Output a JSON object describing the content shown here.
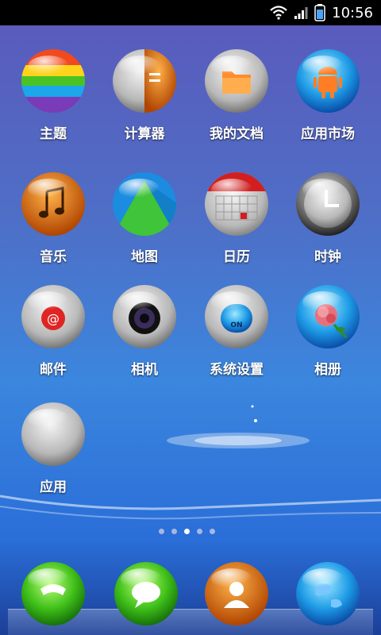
{
  "status_bar": {
    "time": "10:56",
    "icons": [
      "wifi-icon",
      "signal-icon",
      "battery-icon"
    ]
  },
  "apps": [
    {
      "label": "主题",
      "icon": "theme-icon"
    },
    {
      "label": "计算器",
      "icon": "calculator-icon"
    },
    {
      "label": "我的文档",
      "icon": "folder-icon"
    },
    {
      "label": "应用市场",
      "icon": "android-market-icon"
    },
    {
      "label": "音乐",
      "icon": "music-icon"
    },
    {
      "label": "地图",
      "icon": "map-icon"
    },
    {
      "label": "日历",
      "icon": "calendar-icon"
    },
    {
      "label": "时钟",
      "icon": "clock-icon"
    },
    {
      "label": "邮件",
      "icon": "mail-icon"
    },
    {
      "label": "相机",
      "icon": "camera-icon"
    },
    {
      "label": "系统设置",
      "icon": "settings-icon"
    },
    {
      "label": "相册",
      "icon": "gallery-icon"
    },
    {
      "label": "应用",
      "icon": "app-drawer-icon"
    }
  ],
  "pager": {
    "count": 5,
    "active": 3
  },
  "dock": [
    "phone-icon",
    "messaging-icon",
    "contacts-icon",
    "browser-icon"
  ],
  "colors": {
    "bg_top": "#5b59ba",
    "bg_bottom": "#2a6ed8",
    "status_bar": "#000000"
  }
}
